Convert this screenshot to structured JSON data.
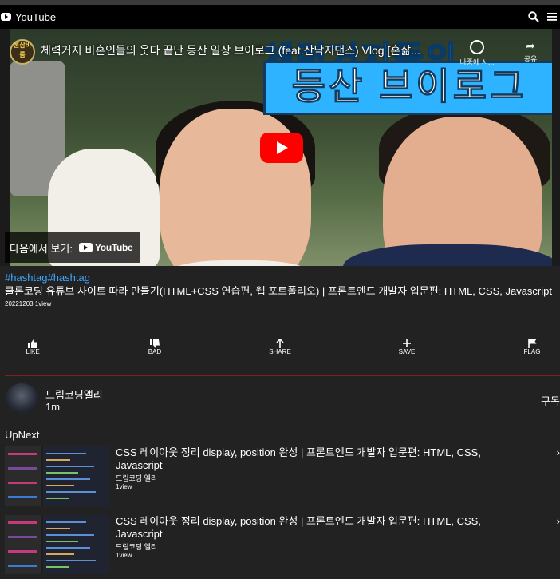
{
  "header": {
    "logo_text": "YouTube",
    "search_icon": "search-icon",
    "menu_icon": "hamburger-menu-icon"
  },
  "video": {
    "channel_badge": "혼삼비룸",
    "title": "체력거지 비혼인들의 웃다 끝난 등산 일상 브이로그 (feat.산낙지댄스) Vlog [혼삶...",
    "banner_line1": "체력거지들의",
    "banner_line2": "등산 브이로그",
    "watch_later_label": "나중에 시...",
    "share_label": "공유",
    "watch_on_label": "다음에서 보기:",
    "watch_on_brand": "YouTube"
  },
  "info": {
    "hashtags": "#hashtag#hashtag",
    "title": "클론코딩 유튜브 사이트 따라 만들기(HTML+CSS 연습편, 웹 포트폴리오) | 프론트엔드 개발자 입문편: HTML, CSS, Javascript",
    "meta": "20221203 1view"
  },
  "actions": [
    {
      "label": "LIKE",
      "icon": "thumbs-up-icon"
    },
    {
      "label": "BAD",
      "icon": "thumbs-down-icon"
    },
    {
      "label": "SHARE",
      "icon": "share-icon"
    },
    {
      "label": "SAVE",
      "icon": "plus-icon"
    },
    {
      "label": "FLAG",
      "icon": "flag-icon"
    }
  ],
  "channel": {
    "name": "드림코딩앨리",
    "subscribers": "1m",
    "subscribe_label": "구독"
  },
  "upnext": {
    "heading": "UpNext",
    "items": [
      {
        "title": "CSS 레이아웃 정리 display, position 완성 | 프론트엔드 개발자 입문편: HTML, CSS, Javascript",
        "channel": "드림코딩 엘리",
        "views": "1view"
      },
      {
        "title": "CSS 레이아웃 정리 display, position 완성 | 프론트엔드 개발자 입문편: HTML, CSS, Javascript",
        "channel": "드림코딩 엘리",
        "views": "1view"
      }
    ]
  }
}
